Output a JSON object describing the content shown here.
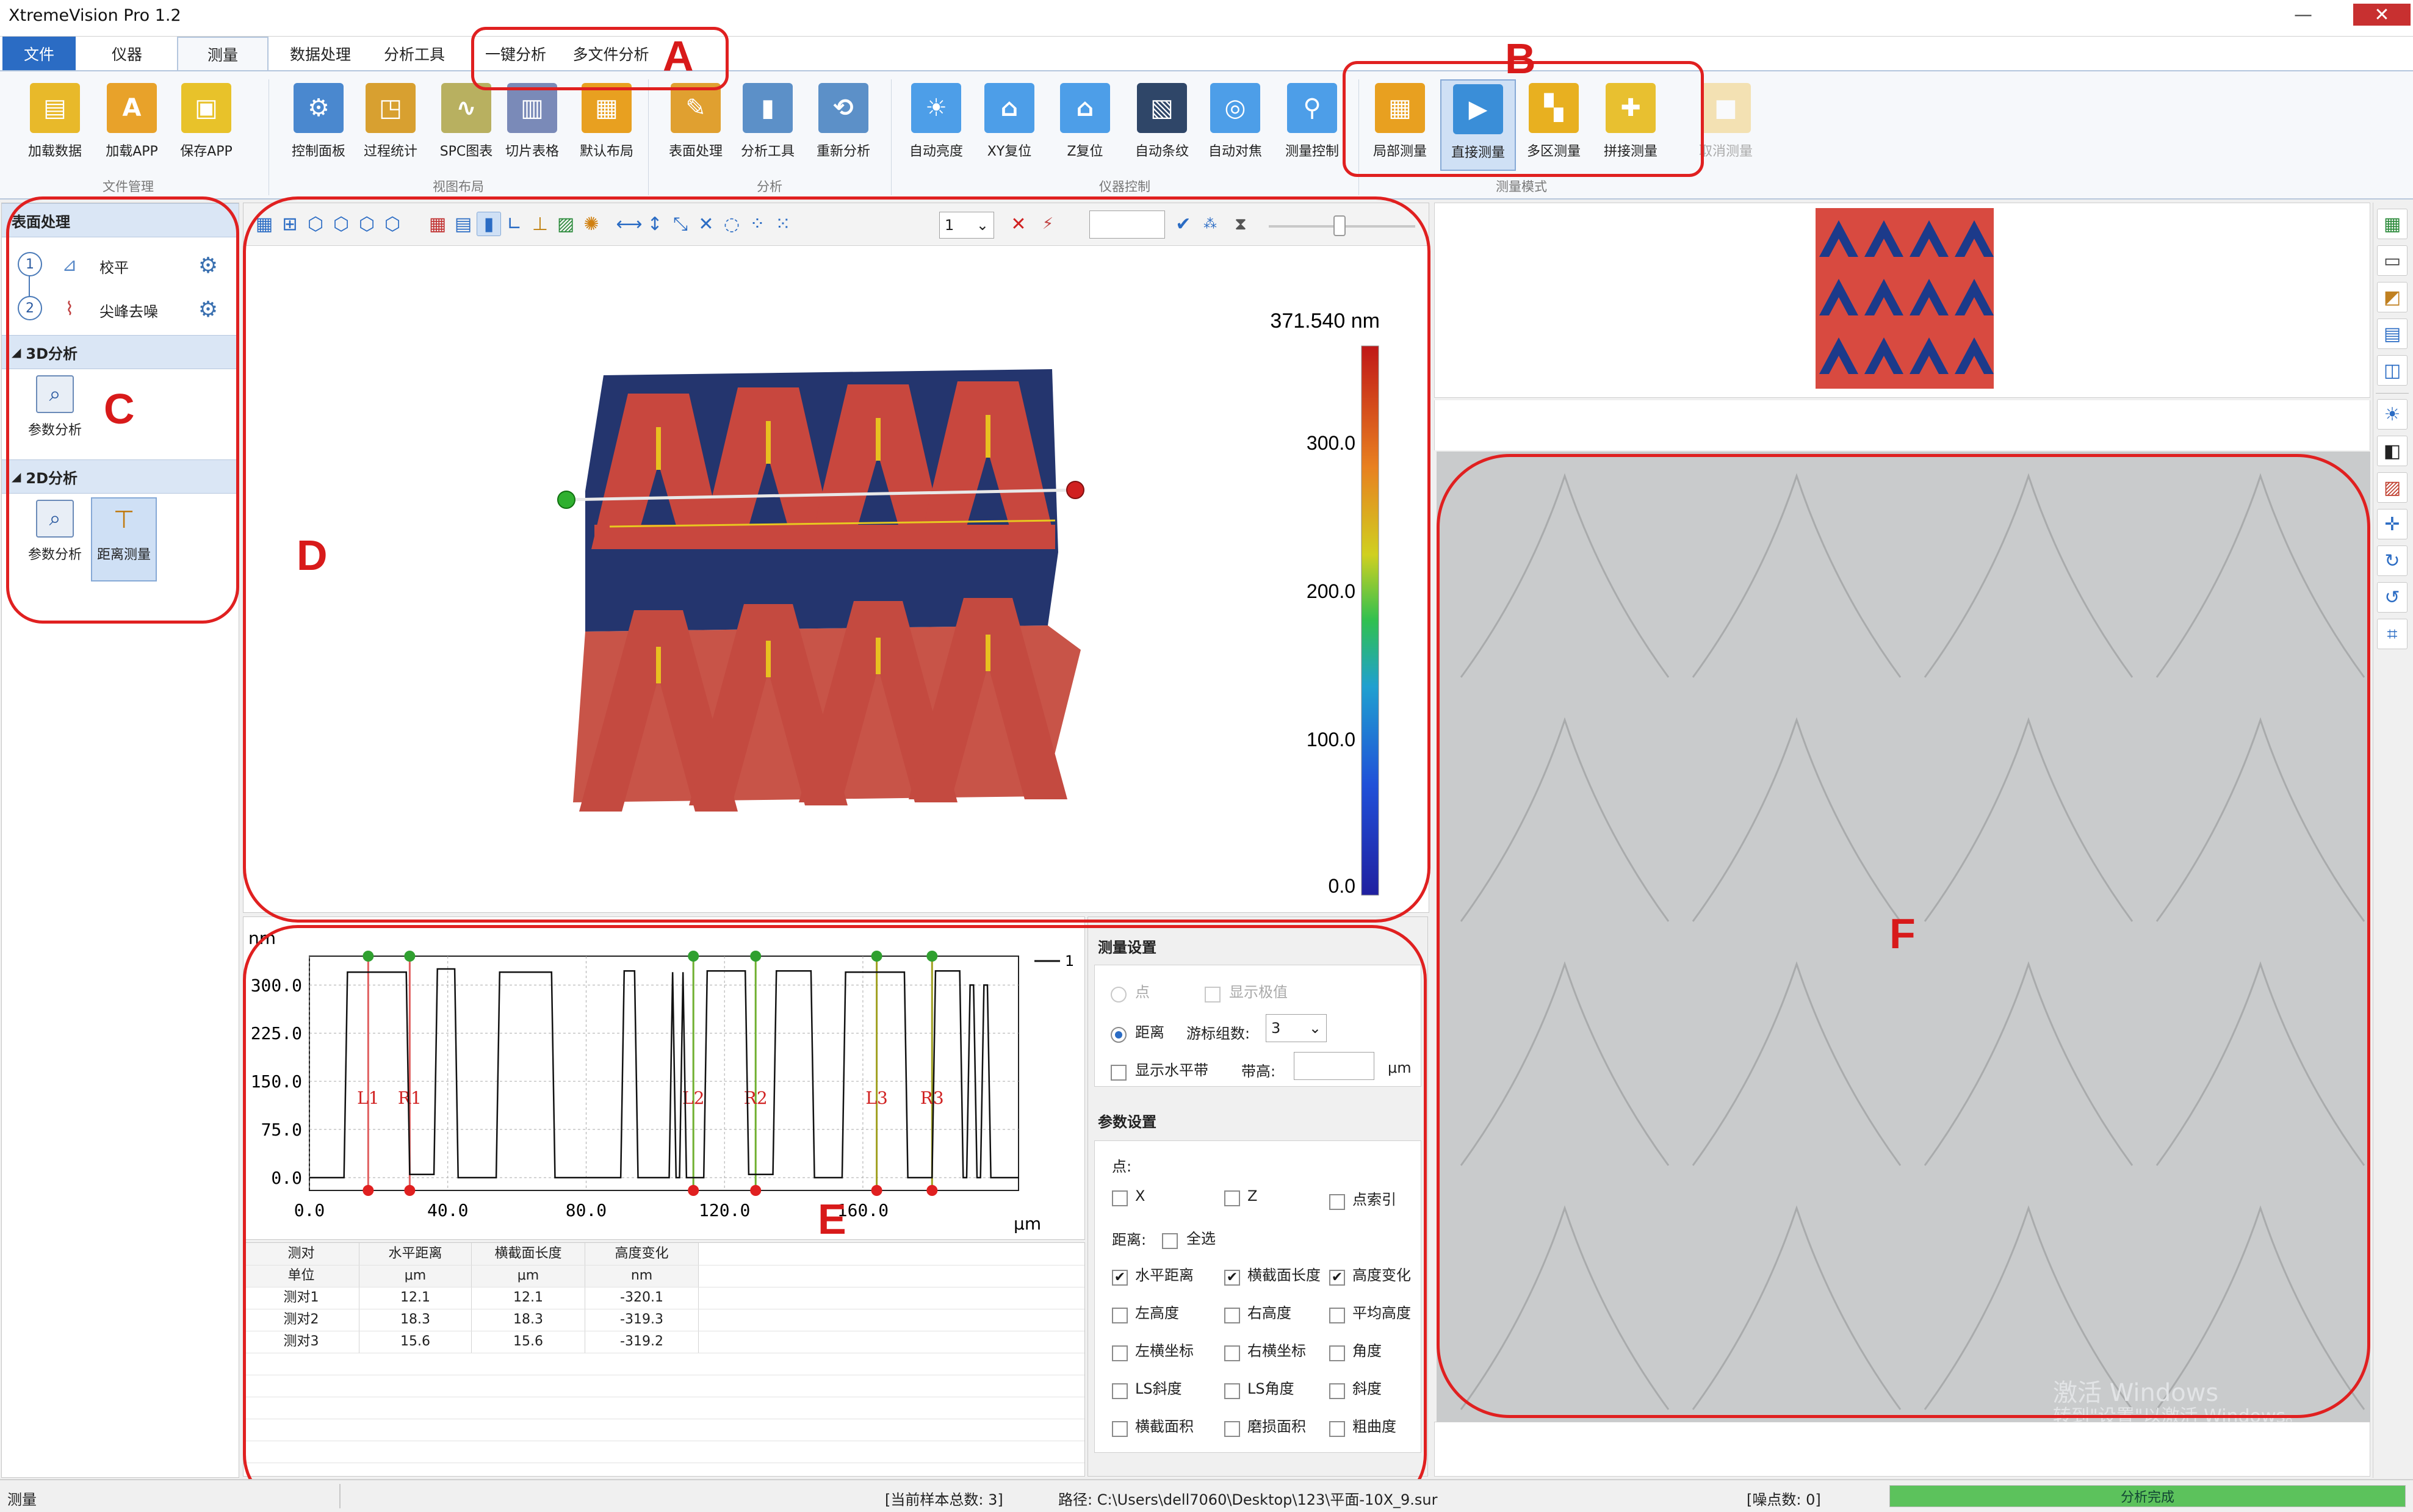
{
  "window": {
    "title": "XtremeVision Pro 1.2"
  },
  "tabs": [
    {
      "label": "文件"
    },
    {
      "label": "仪器"
    },
    {
      "label": "测量"
    },
    {
      "label": "数据处理"
    },
    {
      "label": "分析工具"
    },
    {
      "label": "一键分析"
    },
    {
      "label": "多文件分析"
    }
  ],
  "ribbon": {
    "groups": [
      "文件管理",
      "视图布局",
      "分析",
      "仪器控制",
      "测量模式"
    ],
    "buttons": [
      {
        "label": "加载数据",
        "icon": "folder-icon",
        "color": "#e8b92a"
      },
      {
        "label": "加载APP",
        "icon": "app-folder-icon",
        "color": "#e8a22a"
      },
      {
        "label": "保存APP",
        "icon": "save-icon",
        "color": "#e8c22a"
      },
      {
        "label": "控制面板",
        "icon": "gears-icon",
        "color": "#4a88cf"
      },
      {
        "label": "过程统计",
        "icon": "process-stats-icon",
        "color": "#d8a030"
      },
      {
        "label": "SPC图表",
        "icon": "spc-chart-icon",
        "color": "#b8b060"
      },
      {
        "label": "切片表格",
        "icon": "slice-table-icon",
        "color": "#7a8ab8"
      },
      {
        "label": "默认布局",
        "icon": "default-layout-icon",
        "color": "#e8a020"
      },
      {
        "label": "表面处理",
        "icon": "surface-brush-icon",
        "color": "#e0a030"
      },
      {
        "label": "分析工具",
        "icon": "analysis-tools-icon",
        "color": "#5c90c8"
      },
      {
        "label": "重新分析",
        "icon": "reanalyze-icon",
        "color": "#5c90c8"
      },
      {
        "label": "自动亮度",
        "icon": "sun-icon",
        "color": "#4d9ee8"
      },
      {
        "label": "XY复位",
        "icon": "xy-reset-icon",
        "color": "#4d9ee8"
      },
      {
        "label": "Z复位",
        "icon": "z-reset-icon",
        "color": "#4d9ee8"
      },
      {
        "label": "自动条纹",
        "icon": "fringe-icon",
        "color": "#2f4668"
      },
      {
        "label": "自动对焦",
        "icon": "autofocus-icon",
        "color": "#4d9ee8"
      },
      {
        "label": "测量控制",
        "icon": "microscope-icon",
        "color": "#4d9ee8"
      },
      {
        "label": "局部测量",
        "icon": "local-measure-icon",
        "color": "#e8a020"
      },
      {
        "label": "直接测量",
        "icon": "direct-measure-icon",
        "color": "#3a8ed8"
      },
      {
        "label": "多区测量",
        "icon": "multi-area-icon",
        "color": "#e8b020"
      },
      {
        "label": "拼接测量",
        "icon": "stitch-puzzle-icon",
        "color": "#e8c030"
      },
      {
        "label": "取消测量",
        "icon": "cancel-measure-icon",
        "color": "#f0b830"
      }
    ]
  },
  "annotations": {
    "A": "A",
    "B": "B",
    "C": "C",
    "D": "D",
    "E": "E",
    "F": "F"
  },
  "left_panel": {
    "sections": [
      {
        "title": "表面处理"
      },
      {
        "title": "3D分析"
      },
      {
        "title": "2D分析"
      }
    ],
    "surface_steps": [
      {
        "num": "1",
        "label": "校平"
      },
      {
        "num": "2",
        "label": "尖峰去噪"
      }
    ],
    "analysis_3d": [
      {
        "label": "参数分析"
      }
    ],
    "analysis_2d": [
      {
        "label": "参数分析"
      },
      {
        "label": "距离测量"
      }
    ]
  },
  "toolbar": {
    "spin_value": "1"
  },
  "view3d": {
    "max_label": "371.540 nm",
    "scale_ticks": [
      "300.0",
      "200.0",
      "100.0",
      "0.0"
    ]
  },
  "profile_chart": {
    "ylabel": "nm",
    "xlabel": "μm",
    "legend": "1"
  },
  "chart_data": {
    "type": "line",
    "xlabel": "μm",
    "ylabel": "nm",
    "xlim": [
      0,
      205
    ],
    "ylim": [
      -20,
      345
    ],
    "x_ticks": [
      "0.0",
      "40.0",
      "80.0",
      "120.0",
      "160.0"
    ],
    "y_ticks": [
      "0.0",
      "75.0",
      "150.0",
      "225.0",
      "300.0"
    ],
    "series": [
      {
        "name": "1",
        "points": [
          [
            0,
            0
          ],
          [
            10,
            0
          ],
          [
            11,
            320
          ],
          [
            28,
            320
          ],
          [
            29,
            5
          ],
          [
            36,
            5
          ],
          [
            37,
            325
          ],
          [
            42,
            325
          ],
          [
            43,
            0
          ],
          [
            54,
            0
          ],
          [
            55,
            320
          ],
          [
            70,
            320
          ],
          [
            71,
            0
          ],
          [
            90,
            0
          ],
          [
            91,
            322
          ],
          [
            94,
            322
          ],
          [
            95,
            0
          ],
          [
            104,
            0
          ],
          [
            105,
            320
          ],
          [
            106,
            0
          ],
          [
            107,
            0
          ],
          [
            108,
            320
          ],
          [
            109,
            0
          ],
          [
            114,
            0
          ],
          [
            115,
            322
          ],
          [
            126,
            322
          ],
          [
            127,
            5
          ],
          [
            134,
            5
          ],
          [
            135,
            322
          ],
          [
            145,
            322
          ],
          [
            146,
            0
          ],
          [
            154,
            0
          ],
          [
            155,
            320
          ],
          [
            172,
            320
          ],
          [
            173,
            0
          ],
          [
            180,
            0
          ],
          [
            181,
            322
          ],
          [
            188,
            322
          ],
          [
            189,
            0
          ],
          [
            190,
            0
          ],
          [
            191,
            300
          ],
          [
            192,
            300
          ],
          [
            193,
            0
          ],
          [
            194,
            0
          ],
          [
            195,
            300
          ],
          [
            196,
            300
          ],
          [
            197,
            0
          ],
          [
            205,
            0
          ]
        ]
      }
    ],
    "cursors": [
      {
        "label": "L1",
        "x": 17,
        "color": "#e06060",
        "marker": "#e02020"
      },
      {
        "label": "R1",
        "x": 29,
        "color": "#e06060",
        "marker": "#e02020"
      },
      {
        "label": "L2",
        "x": 111,
        "color": "#70b030",
        "marker": "#e02020"
      },
      {
        "label": "R2",
        "x": 129,
        "color": "#70b030",
        "marker": "#e02020"
      },
      {
        "label": "L3",
        "x": 164,
        "color": "#a0a020",
        "marker": "#e02020"
      },
      {
        "label": "R3",
        "x": 180,
        "color": "#a0a020",
        "marker": "#e02020"
      }
    ]
  },
  "table": {
    "headers": [
      "测对",
      "水平距离",
      "横截面长度",
      "高度变化"
    ],
    "units": [
      "单位",
      "μm",
      "μm",
      "nm"
    ],
    "rows": [
      [
        "测对1",
        "12.1",
        "12.1",
        "-320.1"
      ],
      [
        "测对2",
        "18.3",
        "18.3",
        "-319.3"
      ],
      [
        "测对3",
        "15.6",
        "15.6",
        "-319.2"
      ]
    ]
  },
  "measure_settings": {
    "title": "测量设置",
    "point_label": "点",
    "show_extreme": "显示极值",
    "distance_label": "距离",
    "cursor_groups_label": "游标组数:",
    "cursor_groups_value": "3",
    "show_level": "显示水平带",
    "band_label": "带高:",
    "band_unit": "μm"
  },
  "param_settings": {
    "title": "参数设置",
    "point_label": "点:",
    "point_opts": [
      {
        "label": "X",
        "checked": false
      },
      {
        "label": "Z",
        "checked": false
      },
      {
        "label": "点索引",
        "checked": false
      }
    ],
    "distance_label": "距离:",
    "select_all": "全选",
    "grid": [
      [
        {
          "label": "水平距离",
          "checked": true
        },
        {
          "label": "横截面长度",
          "checked": true
        },
        {
          "label": "高度变化",
          "checked": true
        }
      ],
      [
        {
          "label": "左高度",
          "checked": false
        },
        {
          "label": "右高度",
          "checked": false
        },
        {
          "label": "平均高度",
          "checked": false
        }
      ],
      [
        {
          "label": "左横坐标",
          "checked": false
        },
        {
          "label": "右横坐标",
          "checked": false
        },
        {
          "label": "角度",
          "checked": false
        }
      ],
      [
        {
          "label": "LS斜度",
          "checked": false
        },
        {
          "label": "LS角度",
          "checked": false
        },
        {
          "label": "斜度",
          "checked": false
        }
      ],
      [
        {
          "label": "横截面积",
          "checked": false
        },
        {
          "label": "磨损面积",
          "checked": false
        },
        {
          "label": "粗曲度",
          "checked": false
        }
      ]
    ]
  },
  "watermark": {
    "line1": "激活 Windows",
    "line2": "转到\"设置\"以激活 Windows。"
  },
  "statusbar": {
    "left": "测量",
    "samples": "[当前样本总数: 3]",
    "path": "路径: C:\\Users\\dell7060\\Desktop\\123\\平面-10X_9.sur",
    "noise": "[噪点数: 0]",
    "progress": 1.0,
    "progress_text": "分析完成"
  }
}
